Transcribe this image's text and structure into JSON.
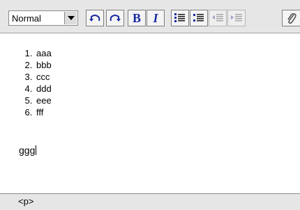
{
  "toolbar": {
    "format_select": {
      "value": "Normal"
    },
    "buttons": {
      "undo": {
        "icon": "undo-icon"
      },
      "redo": {
        "icon": "redo-icon"
      },
      "bold": {
        "label": "B"
      },
      "italic": {
        "label": "I"
      },
      "numbered_list": {
        "icon": "numbered-list-icon"
      },
      "bulleted_list": {
        "icon": "bulleted-list-icon"
      },
      "outdent": {
        "icon": "outdent-icon",
        "enabled": false
      },
      "indent": {
        "icon": "indent-icon",
        "enabled": false
      },
      "attach": {
        "icon": "paperclip-icon"
      }
    }
  },
  "content": {
    "list_items": [
      "aaa",
      "bbb",
      "ccc",
      "ddd",
      "eee",
      "fff"
    ],
    "paragraph": "ggg"
  },
  "status_bar": {
    "path": "<p>"
  },
  "colors": {
    "toolbar_bg": "#e6e6e6",
    "icon_blue": "#1b2aa0",
    "disabled_icon": "#9aa0c8"
  }
}
